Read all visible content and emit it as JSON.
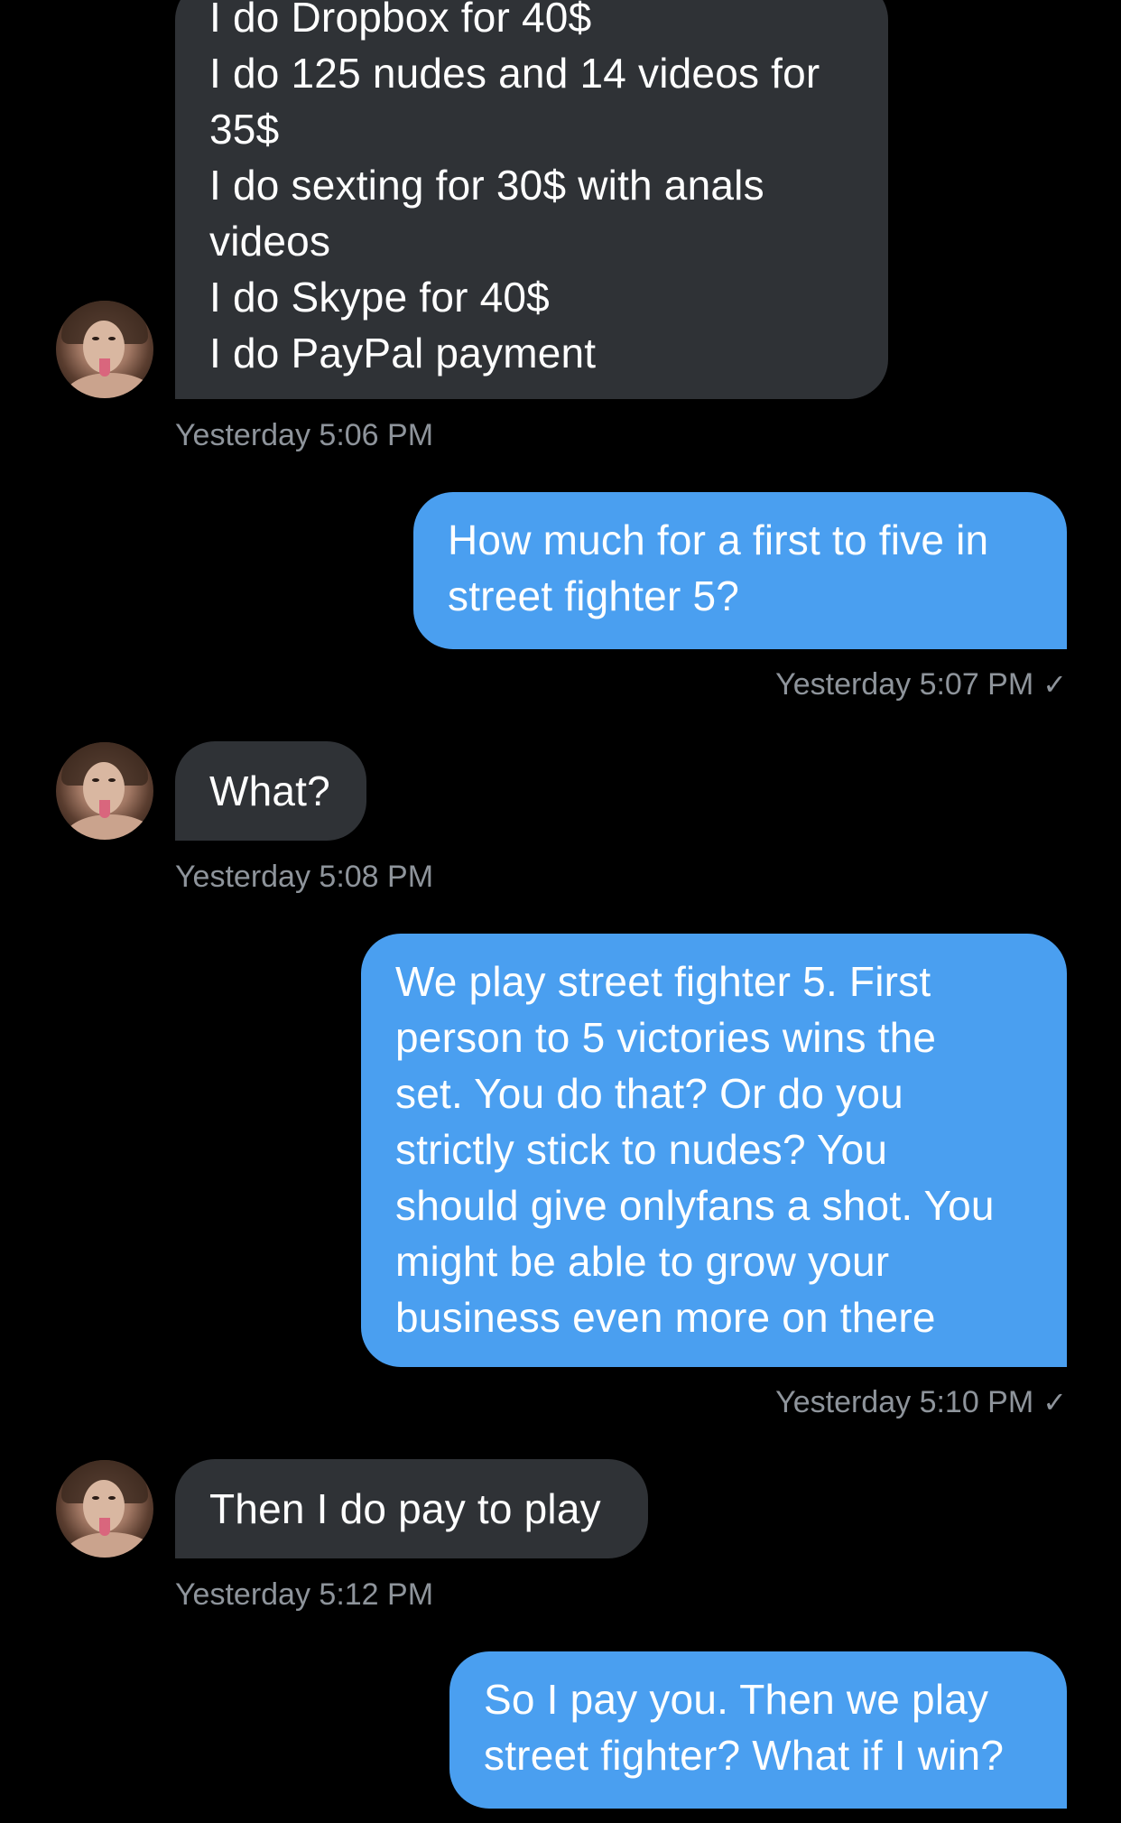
{
  "messages": [
    {
      "text": "I do Dropbox for 40$\nI do 125 nudes and 14 videos for\n35$\nI do sexting for 30$ with anals\nvideos\nI do Skype for 40$\nI do PayPal payment",
      "timestamp": "Yesterday 5:06 PM"
    },
    {
      "text": "How much for a first to five in\nstreet fighter 5?",
      "timestamp": "Yesterday 5:07 PM"
    },
    {
      "text": "What?",
      "timestamp": "Yesterday 5:08 PM"
    },
    {
      "text": "We play street fighter 5. First\nperson to 5 victories wins the\nset. You do that? Or do you\nstrictly stick to nudes? You\nshould give onlyfans a shot. You\nmight be able to grow your\nbusiness even more on there",
      "timestamp": "Yesterday 5:10 PM"
    },
    {
      "text": "Then I do pay to play",
      "timestamp": "Yesterday 5:12 PM"
    },
    {
      "text": "So I pay you. Then we play\nstreet fighter? What if I win?"
    }
  ],
  "icons": {
    "read_receipt": "✓"
  },
  "colors": {
    "background": "#000000",
    "incoming_bubble": "#2f3236",
    "outgoing_bubble": "#4a9ff0",
    "timestamp_text": "#8e949b"
  }
}
